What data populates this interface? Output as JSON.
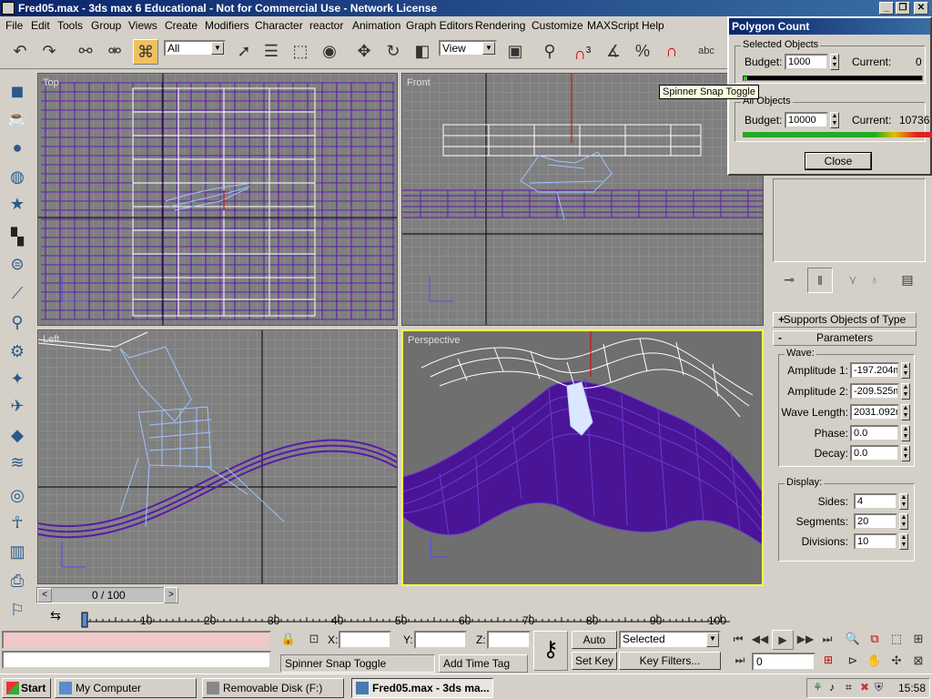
{
  "window": {
    "title": "Fred05.max - 3ds max 6 Educational - Not for Commercial Use - Network License"
  },
  "menu": [
    "File",
    "Edit",
    "Tools",
    "Group",
    "Views",
    "Create",
    "Modifiers",
    "Character",
    "reactor",
    "Animation",
    "Graph Editors",
    "Rendering",
    "Customize",
    "MAXScript",
    "Help"
  ],
  "toolbar": {
    "selection_filter": "All",
    "ref_coord": "View",
    "snap_angle": "3",
    "snap_percent": "%"
  },
  "tooltip": "Spinner Snap Toggle",
  "viewports": {
    "top": "Top",
    "front": "Front",
    "left": "Left",
    "perspective": "Perspective"
  },
  "polygon_count": {
    "title": "Polygon Count",
    "selected_group": "Selected Objects",
    "selected_budget_label": "Budget:",
    "selected_budget": "1000",
    "selected_current_label": "Current:",
    "selected_current": "0",
    "all_group": "All Objects",
    "all_budget_label": "Budget:",
    "all_budget": "10000",
    "all_current_label": "Current:",
    "all_current": "10736",
    "close": "Close"
  },
  "command_panel": {
    "supports_rollout": "Supports Objects of Type",
    "supports_sign": "+",
    "params_rollout": "Parameters",
    "params_sign": "-",
    "wave_group": "Wave:",
    "amplitude1_label": "Amplitude 1:",
    "amplitude1": "-197.204m",
    "amplitude2_label": "Amplitude 2:",
    "amplitude2": "-209.525m",
    "wavelength_label": "Wave Length:",
    "wavelength": "2031.092m",
    "phase_label": "Phase:",
    "phase": "0.0",
    "decay_label": "Decay:",
    "decay": "0.0",
    "display_group": "Display:",
    "sides_label": "Sides:",
    "sides": "4",
    "segments_label": "Segments:",
    "segments": "20",
    "divisions_label": "Divisions:",
    "divisions": "10"
  },
  "timeslider": {
    "label": "0 / 100",
    "prev": "<",
    "next": ">"
  },
  "ruler_ticks": [
    "0",
    "10",
    "20",
    "30",
    "40",
    "50",
    "60",
    "70",
    "80",
    "90",
    "100"
  ],
  "status": {
    "x_label": "X:",
    "y_label": "Y:",
    "z_label": "Z:",
    "prompt": "Spinner Snap Toggle",
    "add_time_tag": "Add Time Tag",
    "auto_key": "Auto Key",
    "set_key": "Set Key",
    "key_mode": "Selected",
    "key_filters": "Key Filters...",
    "frame": "0"
  },
  "taskbar": {
    "start": "Start",
    "items": [
      "My Computer",
      "Removable Disk (F:)",
      "Fred05.max - 3ds ma..."
    ],
    "clock": "15:58"
  }
}
